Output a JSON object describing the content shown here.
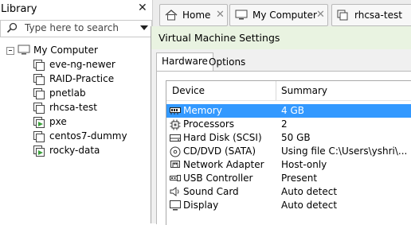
{
  "library": {
    "title": "Library",
    "search_placeholder": "Type here to search",
    "tree": {
      "root": "My Computer",
      "vms": [
        {
          "name": "eve-ng-newer",
          "running": false
        },
        {
          "name": "RAID-Practice",
          "running": false
        },
        {
          "name": "pnetlab",
          "running": false
        },
        {
          "name": "rhcsa-test",
          "running": false
        },
        {
          "name": "pxe",
          "running": true
        },
        {
          "name": "centos7-dummy",
          "running": false
        },
        {
          "name": "rocky-data",
          "running": true
        }
      ]
    }
  },
  "tabs": [
    {
      "label": "Home",
      "icon": "home-icon"
    },
    {
      "label": "My Computer",
      "icon": "computer-icon"
    },
    {
      "label": "rhcsa-test",
      "icon": "vm-icon"
    }
  ],
  "dialog": {
    "title": "Virtual Machine Settings",
    "tabs": [
      "Hardware",
      "Options"
    ],
    "columns": {
      "device": "Device",
      "summary": "Summary"
    },
    "hardware": [
      {
        "device": "Memory",
        "summary": "4 GB",
        "icon": "memory-icon",
        "selected": true
      },
      {
        "device": "Processors",
        "summary": "2",
        "icon": "processor-icon",
        "selected": false
      },
      {
        "device": "Hard Disk (SCSI)",
        "summary": "50 GB",
        "icon": "hard-disk-icon",
        "selected": false
      },
      {
        "device": "CD/DVD (SATA)",
        "summary": "Using file C:\\Users\\yshri\\...",
        "icon": "cd-dvd-icon",
        "selected": false
      },
      {
        "device": "Network Adapter",
        "summary": "Host-only",
        "icon": "network-adapter-icon",
        "selected": false
      },
      {
        "device": "USB Controller",
        "summary": "Present",
        "icon": "usb-icon",
        "selected": false
      },
      {
        "device": "Sound Card",
        "summary": "Auto detect",
        "icon": "sound-card-icon",
        "selected": false
      },
      {
        "device": "Display",
        "summary": "Auto detect",
        "icon": "display-icon",
        "selected": false
      }
    ]
  },
  "colors": {
    "selection": "#3399ff",
    "dialog_titlebar": "#e9f3e1",
    "running_vm": "#3aa13a"
  }
}
